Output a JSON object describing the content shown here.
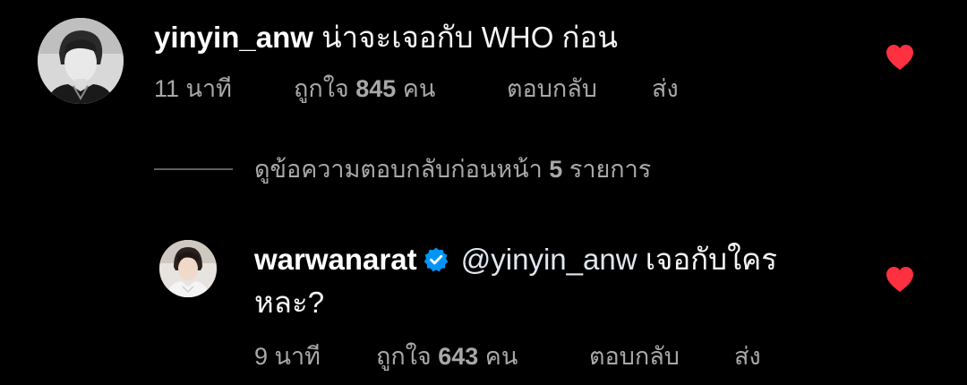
{
  "comments": [
    {
      "username": "yinyin_anw",
      "text": "น่าจะเจอกับ WHO ก่อน",
      "time": "11 นาที",
      "likes_prefix": "ถูกใจ",
      "likes_count": "845",
      "likes_suffix": "คน",
      "reply_label": "ตอบกลับ",
      "send_label": "ส่ง",
      "liked": true,
      "avatar_icon": "profile-photo-grayscale"
    },
    {
      "username": "warwanarat",
      "verified": true,
      "mention": "@yinyin_anw",
      "text_line1": "เจอกับใคร",
      "text_line2": "หละ?",
      "time": "9 นาที",
      "likes_prefix": "ถูกใจ",
      "likes_count": "643",
      "likes_suffix": "คน",
      "reply_label": "ตอบกลับ",
      "send_label": "ส่ง",
      "liked": true,
      "avatar_icon": "profile-photo"
    }
  ],
  "view_replies": {
    "label_prefix": "ดูข้อความตอบกลับก่อนหน้า",
    "count": "5",
    "label_suffix": "รายการ"
  },
  "colors": {
    "background": "#000000",
    "text": "#f5f5f5",
    "meta": "#a8a8a8",
    "heart": "#ff3040",
    "verified": "#0095f6"
  },
  "icons": {
    "heart": "heart-filled-icon",
    "verified": "verified-badge-icon"
  }
}
